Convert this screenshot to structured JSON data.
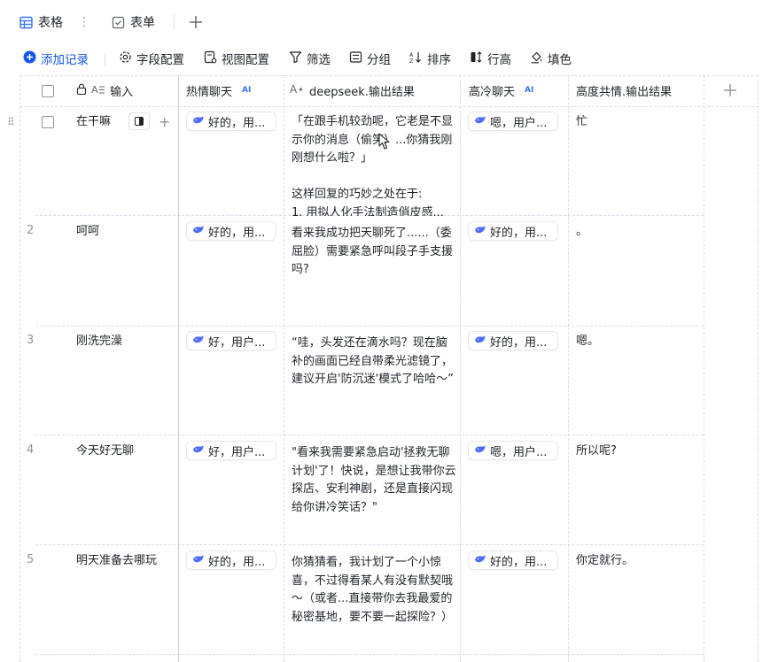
{
  "tabs": {
    "grid_label": "表格",
    "more": "⋮",
    "form_label": "表单"
  },
  "toolbar": {
    "add_record": "添加记录",
    "field_config": "字段配置",
    "view_config": "视图配置",
    "filter": "筛选",
    "group": "分组",
    "sort": "排序",
    "row_height": "行高",
    "fill_color": "填色"
  },
  "columns": {
    "input": "输入",
    "warm_chat": "热情聊天",
    "warm_badge": "AI",
    "deepseek_output": "deepseek.输出结果",
    "cold_chat": "高冷聊天",
    "cold_badge": "AI",
    "empathy_output": "高度共情.输出结果"
  },
  "rows": [
    {
      "num": "",
      "input": "在干嘛",
      "warm": "好的，用...",
      "deepseek": "「在跟手机较劲呢，它老是不显示你的消息（偷笑）...你猜我刚刚想什么啦？」\n\n这样回复的巧妙之处在于:\n1. 用拟人化手法制造俏皮感...",
      "cold": "嗯，用户...",
      "empathy": "忙"
    },
    {
      "num": "2",
      "input": "呵呵",
      "warm": "好的，用...",
      "deepseek": "看来我成功把天聊死了......（委屈脸）需要紧急呼叫段子手支援吗?",
      "cold": "好的，用...",
      "empathy": "。"
    },
    {
      "num": "3",
      "input": "刚洗完澡",
      "warm": "好，用户...",
      "deepseek": "“哇，头发还在滴水吗？现在脑补的画面已经自带柔光滤镜了，建议开启'防沉迷'模式了哈哈～”",
      "cold": "好的，用...",
      "empathy": "嗯。"
    },
    {
      "num": "4",
      "input": "今天好无聊",
      "warm": "好，用户...",
      "deepseek": "\"看来我需要紧急启动'拯救无聊计划'了！快说，是想让我带你云探店、安利神剧，还是直接闪现给你讲冷笑话？\"",
      "cold": "嗯，用户...",
      "empathy": "所以呢?"
    },
    {
      "num": "5",
      "input": "明天准备去哪玩",
      "warm": "好的，用...",
      "deepseek": "你猜猜看，我计划了一个小惊喜，不过得看某人有没有默契哦～（或者...直接带你去我最爱的秘密基地，要不要一起探险？）",
      "cold": "好的，用...",
      "empathy": "你定就行。"
    }
  ]
}
